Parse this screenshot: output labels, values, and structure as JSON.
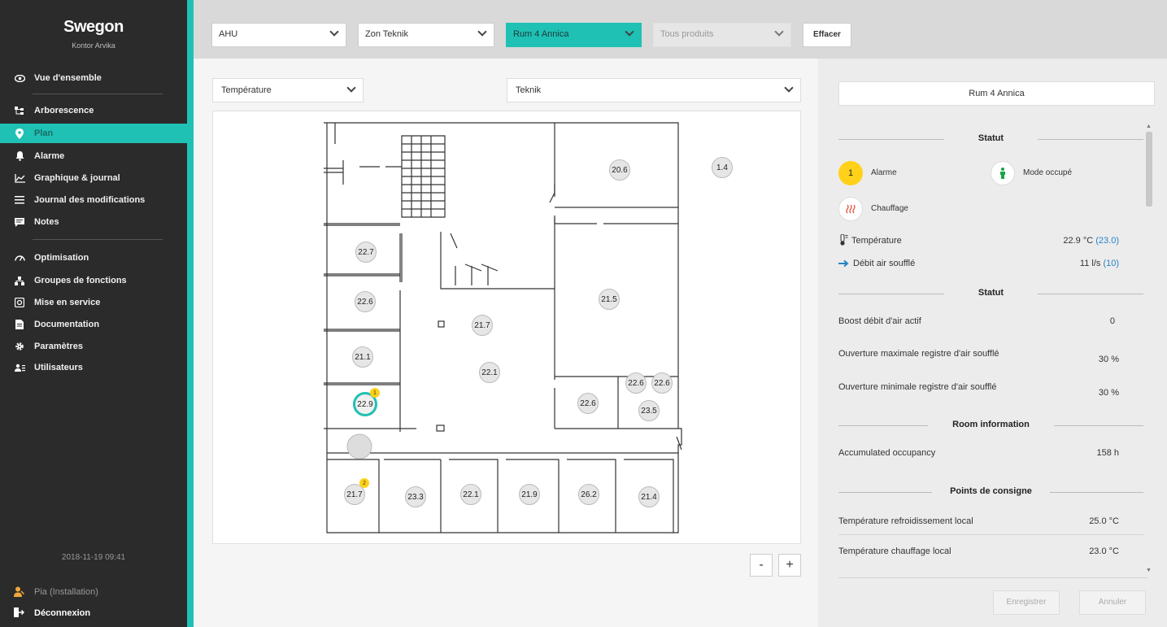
{
  "sidebar": {
    "brand": "Swegon",
    "site": "Kontor Arvika",
    "items": [
      {
        "label": "Vue d'ensemble",
        "icon": "eye-icon"
      },
      {
        "label": "Arborescence",
        "icon": "tree-icon"
      },
      {
        "label": "Plan",
        "icon": "map-pin-icon",
        "active": true
      },
      {
        "label": "Alarme",
        "icon": "bell-icon"
      },
      {
        "label": "Graphique & journal",
        "icon": "chart-icon"
      },
      {
        "label": "Journal des modifications",
        "icon": "list-icon"
      },
      {
        "label": "Notes",
        "icon": "note-icon"
      },
      {
        "label": "Optimisation",
        "icon": "gauge-icon"
      },
      {
        "label": "Groupes de fonctions",
        "icon": "group-icon"
      },
      {
        "label": "Mise en service",
        "icon": "commissioning-icon"
      },
      {
        "label": "Documentation",
        "icon": "document-icon"
      },
      {
        "label": "Paramètres",
        "icon": "gear-icon"
      },
      {
        "label": "Utilisateurs",
        "icon": "users-icon"
      }
    ],
    "datetime": "2018-11-19 09:41",
    "user": "Pia (Installation)",
    "logout": "Déconnexion"
  },
  "topbar": {
    "ahu": "AHU",
    "zone": "Zon Teknik",
    "room": "Rum 4 Annica",
    "products": "Tous produits",
    "clear": "Effacer"
  },
  "main": {
    "filter_left": "Température",
    "filter_right": "Teknik",
    "zoom_out": "-",
    "zoom_in": "+",
    "rooms": [
      {
        "value": "20.6"
      },
      {
        "value": "1.4"
      },
      {
        "value": "22.7"
      },
      {
        "value": "22.6"
      },
      {
        "value": "21.5"
      },
      {
        "value": "21.7"
      },
      {
        "value": "21.1"
      },
      {
        "value": "22.1"
      },
      {
        "value": "22.6"
      },
      {
        "value": "22.6"
      },
      {
        "value": "22.9",
        "alarm": "1",
        "selected": true
      },
      {
        "value": "22.6"
      },
      {
        "value": "23.5"
      },
      {
        "value": "21.7",
        "alarm": "2"
      },
      {
        "value": "23.3"
      },
      {
        "value": "22.1"
      },
      {
        "value": "21.9"
      },
      {
        "value": "26.2"
      },
      {
        "value": "21.4"
      }
    ]
  },
  "panel": {
    "room_title": "Rum 4 Annica",
    "status_header": "Statut",
    "alarm_count": "1",
    "alarm_label": "Alarme",
    "occupied_label": "Mode occupé",
    "heating_label": "Chauffage",
    "temp_label": "Température",
    "temp_value": "22.9",
    "temp_unit": "°C",
    "temp_setpoint": "(23.0)",
    "flow_label": "Débit air soufflé",
    "flow_value": "11",
    "flow_unit": "l/s",
    "flow_setpoint": "(10)",
    "status_header2": "Statut",
    "boost_label": "Boost débit d'air actif",
    "boost_value": "0",
    "max_open_label": "Ouverture maximale registre d'air soufflé",
    "max_open_value": "30 %",
    "min_open_label": "Ouverture minimale registre d'air soufflé",
    "min_open_value": "30 %",
    "room_info_header": "Room information",
    "occupancy_label": "Accumulated occupancy",
    "occupancy_value": "158 h",
    "setpoints_header": "Points de consigne",
    "cooling_label": "Température refroidissement local",
    "cooling_value": "25.0 °C",
    "heating_sp_label": "Température chauffage local",
    "heating_sp_value": "23.0 °C",
    "save": "Enregistrer",
    "cancel": "Annuler"
  },
  "colors": {
    "accent": "#1fc1b4",
    "alarm": "#ffd11a",
    "setpoint": "#2583c7"
  }
}
